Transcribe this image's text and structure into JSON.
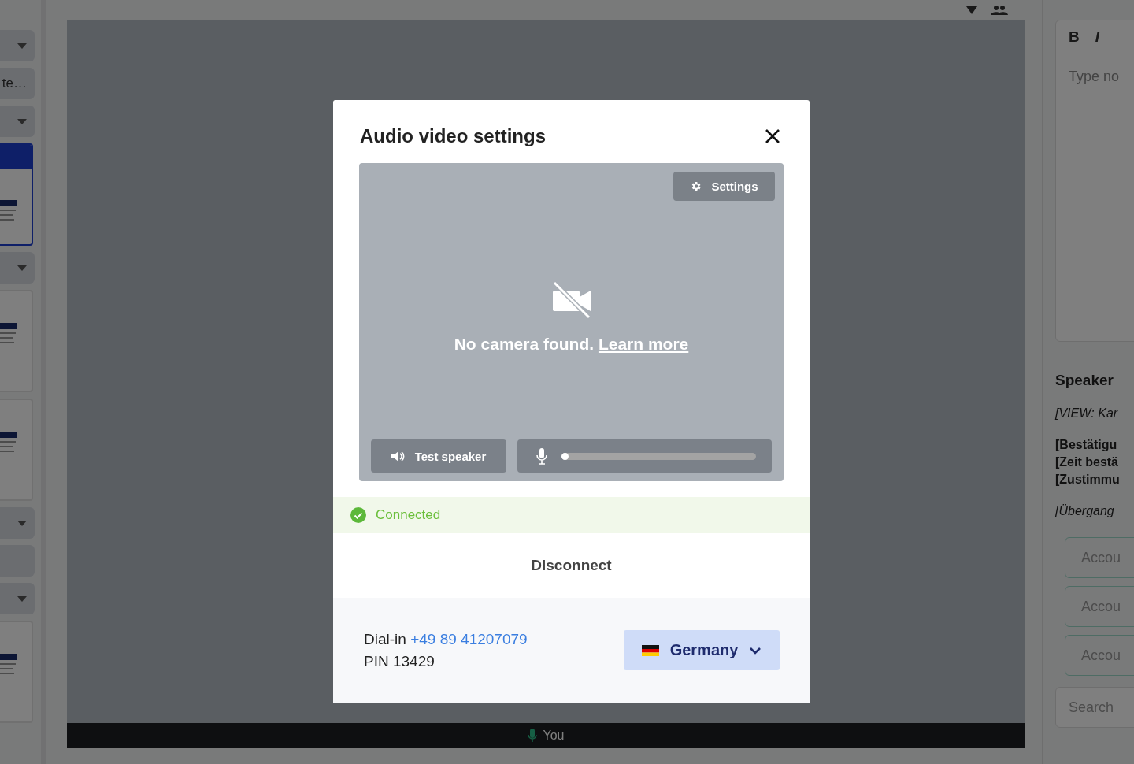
{
  "sidebar": {
    "items": [
      {
        "kind": "caret"
      },
      {
        "kind": "label",
        "text": "te…"
      },
      {
        "kind": "caret"
      },
      {
        "kind": "slide",
        "selected": true
      },
      {
        "kind": "caret"
      },
      {
        "kind": "slide",
        "selected": false
      },
      {
        "kind": "slide",
        "selected": false
      },
      {
        "kind": "caret"
      },
      {
        "kind": "blank"
      },
      {
        "kind": "caret"
      },
      {
        "kind": "slide",
        "selected": false
      }
    ]
  },
  "stage": {
    "participant": "You"
  },
  "notes": {
    "toolbar": [
      "B",
      "I"
    ],
    "placeholder": "Type no",
    "heading": "Speaker",
    "lines": [
      {
        "kind": "italic",
        "text": "[VIEW: Kar"
      },
      {
        "kind": "bold",
        "text": "[Bestätigu"
      },
      {
        "kind": "bold",
        "text": "[Zeit bestä"
      },
      {
        "kind": "bold",
        "text": "[Zustimmu"
      },
      {
        "kind": "italic",
        "text": "[Übergang"
      }
    ],
    "fields": [
      "Accou",
      "Accou",
      "Accou"
    ],
    "search": "Search"
  },
  "dialog": {
    "title": "Audio video settings",
    "preview": {
      "settings_button": "Settings",
      "message": "No camera found.",
      "link": "Learn more",
      "test_speaker": "Test speaker",
      "mic": {
        "level": 0.02
      }
    },
    "status": "Connected",
    "disconnect": "Disconnect",
    "dial_in": {
      "label": "Dial-in",
      "number": "+49 89 41207079",
      "pin": "PIN 13429"
    },
    "country": "Germany"
  }
}
